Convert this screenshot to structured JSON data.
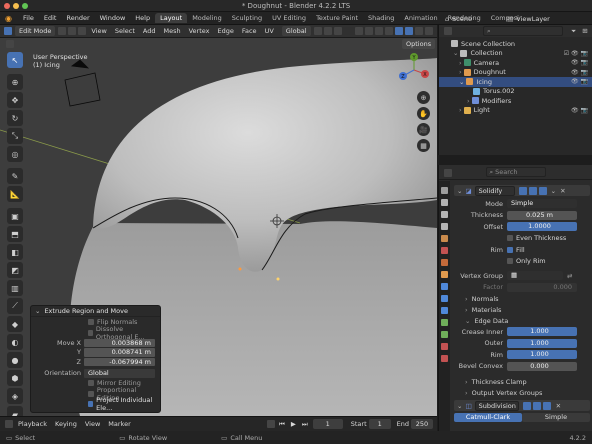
{
  "window": {
    "title": "* Doughnut - Blender 4.2.2 LTS"
  },
  "menu": {
    "items": [
      "File",
      "Edit",
      "Render",
      "Window",
      "Help"
    ],
    "workspaces": [
      "Layout",
      "Modeling",
      "Sculpting",
      "UV Editing",
      "Texture Paint",
      "Shading",
      "Animation",
      "Rendering",
      "Composi"
    ],
    "active_workspace": "Layout",
    "scene": "Scene",
    "view_layer": "ViewLayer"
  },
  "viewport_header": {
    "mode": "Edit Mode",
    "menus": [
      "View",
      "Select",
      "Add",
      "Mesh",
      "Vertex",
      "Edge",
      "Face",
      "UV"
    ],
    "orientation": "Global"
  },
  "viewport": {
    "perspective": "User Perspective",
    "object": "(1) Icing",
    "options_label": "Options",
    "gizmo_axes": {
      "z": "Z",
      "y": "Y",
      "x": "X"
    }
  },
  "last_operator": {
    "title": "Extrude Region and Move",
    "flip_normals": "Flip Normals",
    "dissolve": "Dissolve Orthogonal E...",
    "move_x_label": "Move X",
    "move_x": "0.003868 m",
    "move_y_label": "Y",
    "move_y": "0.008741 m",
    "move_z_label": "Z",
    "move_z": "-0.067994 m",
    "orientation_label": "Orientation",
    "orientation": "Global",
    "mirror": "Mirror Editing",
    "proportional": "Proportional Editing",
    "project": "Project Individual Ele..."
  },
  "timeline": {
    "menus": [
      "Playback",
      "Keying",
      "View",
      "Marker"
    ],
    "current_frame": "1",
    "start_label": "Start",
    "start": "1",
    "end_label": "End",
    "end": "250"
  },
  "statusbar": {
    "select": "Select",
    "rotate": "Rotate View",
    "menu": "Call Menu",
    "version": "4.2.2"
  },
  "outliner": {
    "search_placeholder": "",
    "items": [
      {
        "label": "Scene Collection",
        "color": "#bbbbbb"
      },
      {
        "label": "Collection",
        "color": "#bbbbbb"
      },
      {
        "label": "Camera",
        "color": "#3f8f6b"
      },
      {
        "label": "Doughnut",
        "color": "#e09a4e"
      },
      {
        "label": "Icing",
        "color": "#e09a4e"
      },
      {
        "label": "Torus.002",
        "color": "#6fb0e0"
      },
      {
        "label": "Modifiers",
        "color": "#6f8ed8"
      },
      {
        "label": "Light",
        "color": "#e0b04e"
      }
    ]
  },
  "properties": {
    "search_placeholder": "Search",
    "solidify": {
      "name": "Solidify",
      "mode_label": "Mode",
      "mode": "Simple",
      "thickness_label": "Thickness",
      "thickness": "0.025 m",
      "offset_label": "Offset",
      "offset": "1.0000",
      "even_thickness": "Even Thickness",
      "rim_label": "Rim",
      "fill": "Fill",
      "only_rim": "Only Rim",
      "vertex_group_label": "Vertex Group",
      "factor_label": "Factor",
      "factor": "0.000"
    },
    "subpanels": [
      "Normals",
      "Materials",
      "Edge Data"
    ],
    "edge_data": {
      "crease_inner_label": "Crease Inner",
      "crease_inner": "1.000",
      "outer_label": "Outer",
      "outer": "1.000",
      "rim_label": "Rim",
      "rim": "1.000",
      "bevel_label": "Bevel Convex",
      "bevel": "0.000"
    },
    "more_panels": [
      "Thickness Clamp",
      "Output Vertex Groups"
    ],
    "subdivision": {
      "name": "Subdivision",
      "tab_catmull": "Catmull-Clark",
      "tab_simple": "Simple"
    }
  }
}
